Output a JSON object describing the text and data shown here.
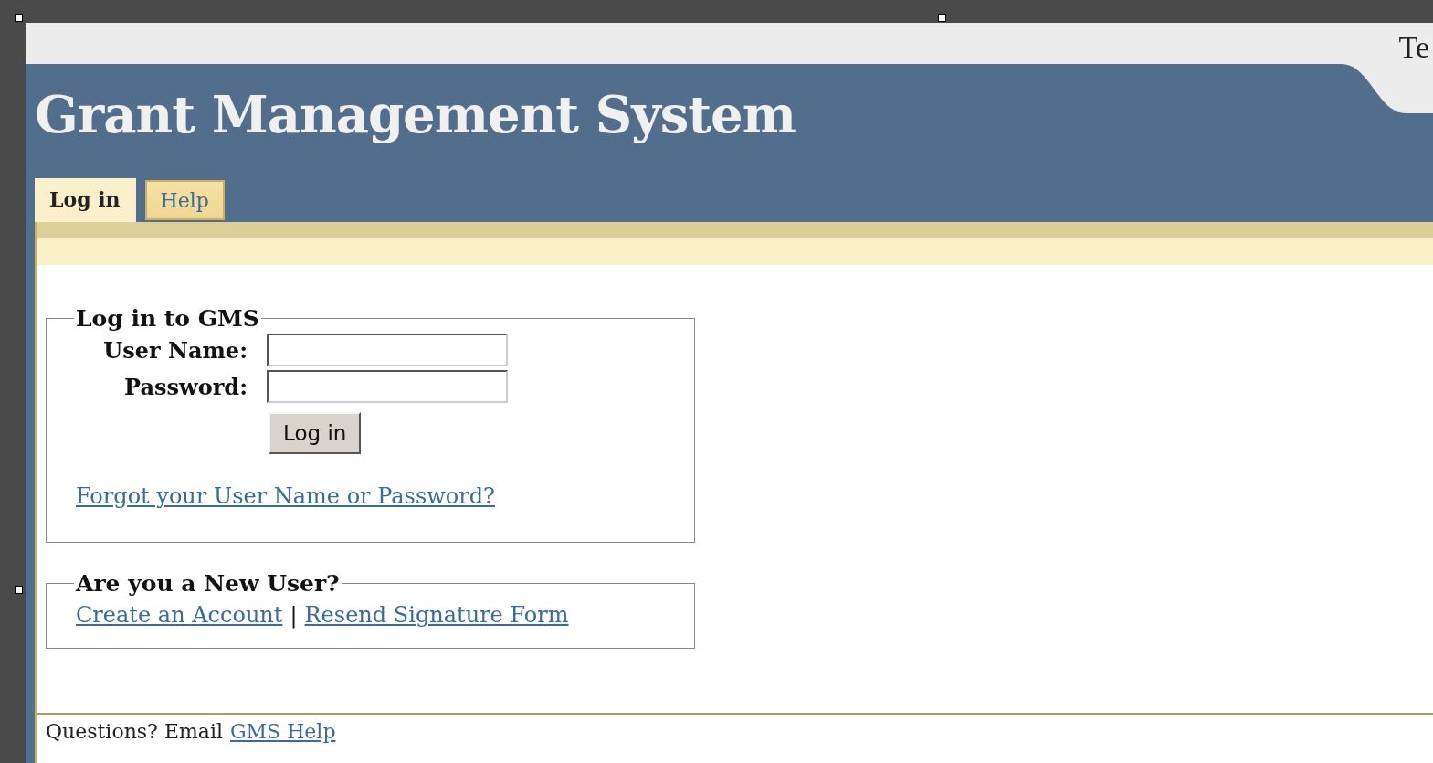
{
  "header": {
    "title": "Grant Management System",
    "corner_text": "Te"
  },
  "tabs": [
    {
      "label": "Log in",
      "selected": true
    },
    {
      "label": "Help",
      "selected": false
    }
  ],
  "login": {
    "legend": "Log in to GMS",
    "fields": [
      {
        "label": "User Name:"
      },
      {
        "label": "Password:"
      }
    ],
    "button": "Log in",
    "forgot_link": "Forgot your User Name or Password?"
  },
  "new_user": {
    "legend": "Are you a New User?",
    "links": [
      "Create an Account",
      "Resend Signature Form"
    ],
    "separator": "|"
  },
  "footer": {
    "text": "Questions? Email",
    "link": "GMS Help"
  }
}
